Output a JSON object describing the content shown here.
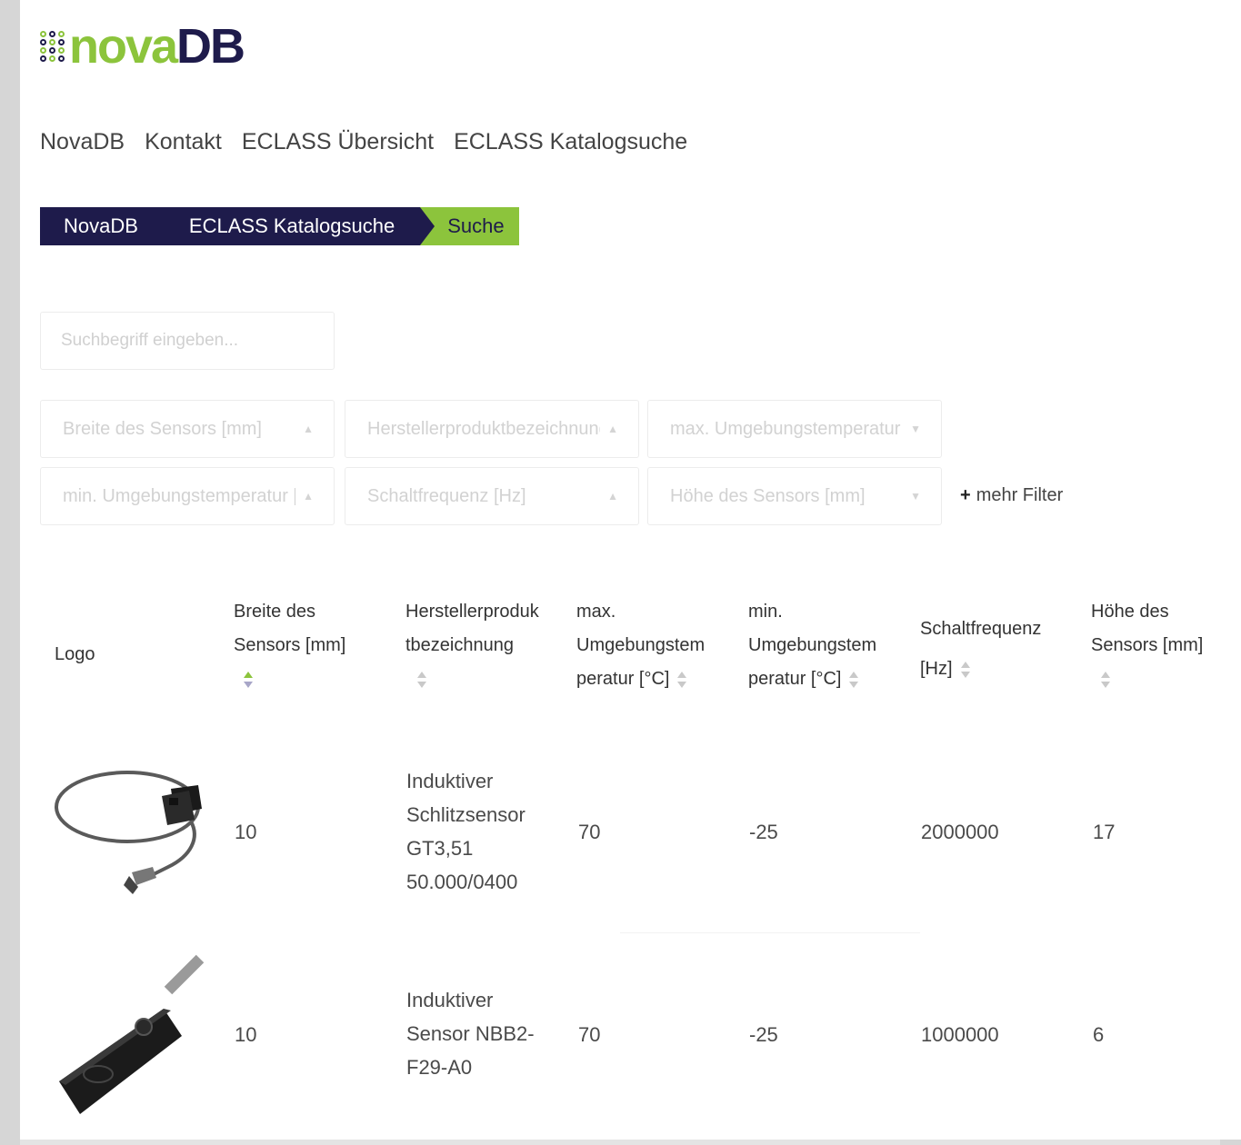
{
  "brand": {
    "logo_text_1": "nova",
    "logo_text_2": "DB",
    "accent_green": "#8cc43c",
    "accent_navy": "#1e1b4b"
  },
  "nav": {
    "items": [
      "NovaDB",
      "Kontakt",
      "ECLASS Übersicht",
      "ECLASS Katalogsuche"
    ]
  },
  "breadcrumb": {
    "items": [
      "NovaDB",
      "ECLASS Katalogsuche",
      "Suche"
    ]
  },
  "search": {
    "placeholder": "Suchbegriff eingeben..."
  },
  "filters": [
    "Breite des Sensors [mm]",
    "Herstellerproduktbezeichnung",
    "max. Umgebungstemperatur [°C]",
    "min. Umgebungstemperatur [°C]",
    "Schaltfrequenz [Hz]",
    "Höhe des Sensors [mm]"
  ],
  "more_filters": {
    "icon": "plus-icon",
    "label": "mehr Filter"
  },
  "table": {
    "headers": {
      "logo": "Logo",
      "breite_l1": "Breite des",
      "breite_l2": "Sensors [mm]",
      "hersteller_l1": "Herstellerproduk",
      "hersteller_l2": "tbezeichnung",
      "max_l1": "max.",
      "max_l2": "Umgebungstem",
      "max_l3": "peratur [°C]",
      "min_l1": "min.",
      "min_l2": "Umgebungstem",
      "min_l3": "peratur [°C]",
      "schalt_l1": "Schaltfrequenz",
      "schalt_l2": "[Hz]",
      "hoehe_l1": "Höhe des",
      "hoehe_l2": "Sensors [mm]"
    },
    "rows": [
      {
        "breite": "10",
        "name_l1": "Induktiver",
        "name_l2": "Schlitzsensor",
        "name_l3": "GT3,51",
        "name_l4": "50.000/0400",
        "max": "70",
        "min": "-25",
        "schalt": "2000000",
        "hoehe": "17"
      },
      {
        "breite": "10",
        "name_l1": "Induktiver",
        "name_l2": "Sensor NBB2-",
        "name_l3": "F29-A0",
        "max": "70",
        "min": "-25",
        "schalt": "1000000",
        "hoehe": "6"
      }
    ]
  }
}
